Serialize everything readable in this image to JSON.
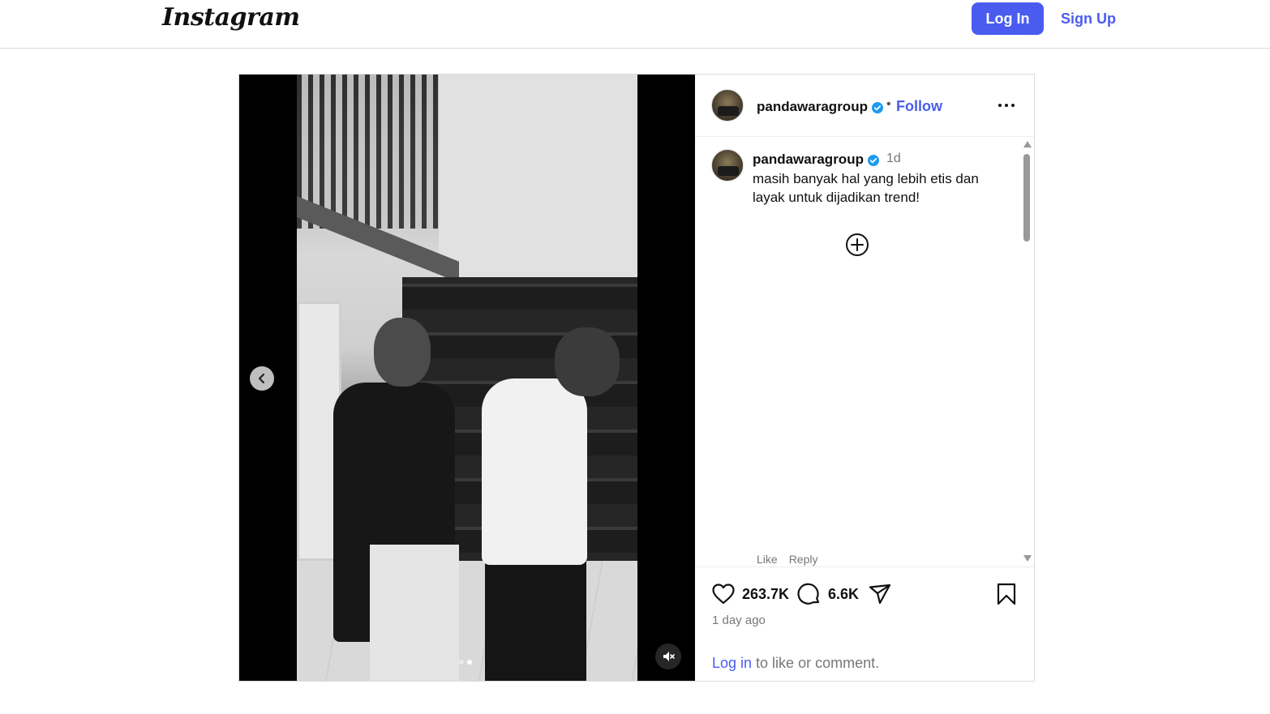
{
  "nav": {
    "logo": "Instagram",
    "login_label": "Log In",
    "signup_label": "Sign Up"
  },
  "post": {
    "username": "pandawaragroup",
    "separator": "•",
    "follow_label": "Follow",
    "media": {
      "slide_count": 2,
      "active_slide": 2
    },
    "caption": {
      "username": "pandawaragroup",
      "time": "1d",
      "text": "masih banyak hal yang lebih etis dan layak untuk dijadikan trend!",
      "like_label": "Like",
      "reply_label": "Reply"
    },
    "stats": {
      "likes": "263.7K",
      "comments": "6.6K"
    },
    "date": "1 day ago",
    "login_prompt": {
      "link": "Log in",
      "text": " to like or comment."
    }
  },
  "colors": {
    "accent": "#4a5cf0",
    "verified": "#1d9bf0"
  },
  "icons": {
    "verified": "verified-badge-icon",
    "more": "more-options-icon",
    "load_more": "plus-circle-icon",
    "like": "heart-icon",
    "comment": "comment-bubble-icon",
    "share": "send-icon",
    "save": "bookmark-icon",
    "prev": "chevron-left-icon",
    "mute": "speaker-muted-icon"
  }
}
